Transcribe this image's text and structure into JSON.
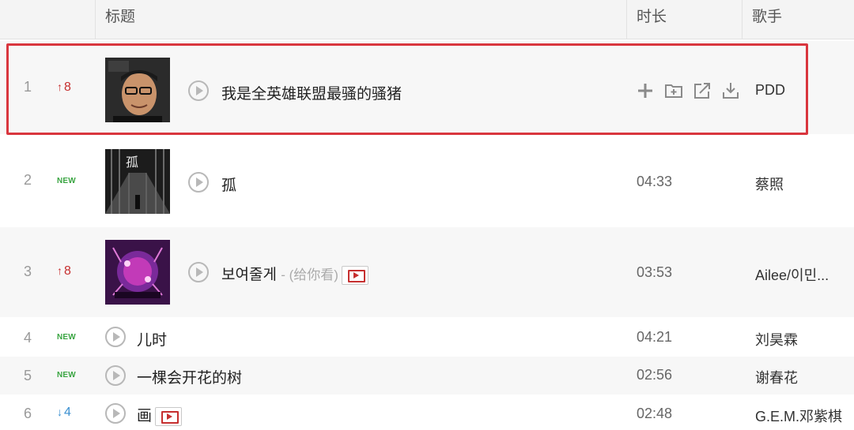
{
  "header": {
    "title_col": "标题",
    "duration_col": "时长",
    "singer_col": "歌手"
  },
  "rows": [
    {
      "rank": "1",
      "trend": "8",
      "trend_type": "up",
      "title": "我是全英雄联盟最骚的骚猪",
      "subtitle": "",
      "mv": false,
      "duration": "",
      "singer": "PDD"
    },
    {
      "rank": "2",
      "trend": "NEW",
      "trend_type": "new",
      "title": "孤",
      "subtitle": "",
      "mv": false,
      "duration": "04:33",
      "singer": "蔡照"
    },
    {
      "rank": "3",
      "trend": "8",
      "trend_type": "up",
      "title": "보여줄게",
      "subtitle": "- (给你看)",
      "mv": true,
      "duration": "03:53",
      "singer": "Ailee/이민..."
    },
    {
      "rank": "4",
      "trend": "NEW",
      "trend_type": "new",
      "title": "儿时",
      "subtitle": "",
      "mv": false,
      "duration": "04:21",
      "singer": "刘昊霖"
    },
    {
      "rank": "5",
      "trend": "NEW",
      "trend_type": "new",
      "title": "一棵会开花的树",
      "subtitle": "",
      "mv": false,
      "duration": "02:56",
      "singer": "谢春花"
    },
    {
      "rank": "6",
      "trend": "4",
      "trend_type": "down",
      "title": "画",
      "subtitle": "",
      "mv": true,
      "duration": "02:48",
      "singer": "G.E.M.邓紫棋"
    }
  ],
  "hover_actions": [
    "add-icon",
    "folder-add-icon",
    "share-icon",
    "download-icon"
  ],
  "colors": {
    "highlight": "#d9363e",
    "trend_up": "#c62f2f",
    "trend_down": "#3a8fd0",
    "new": "#3aa542"
  }
}
